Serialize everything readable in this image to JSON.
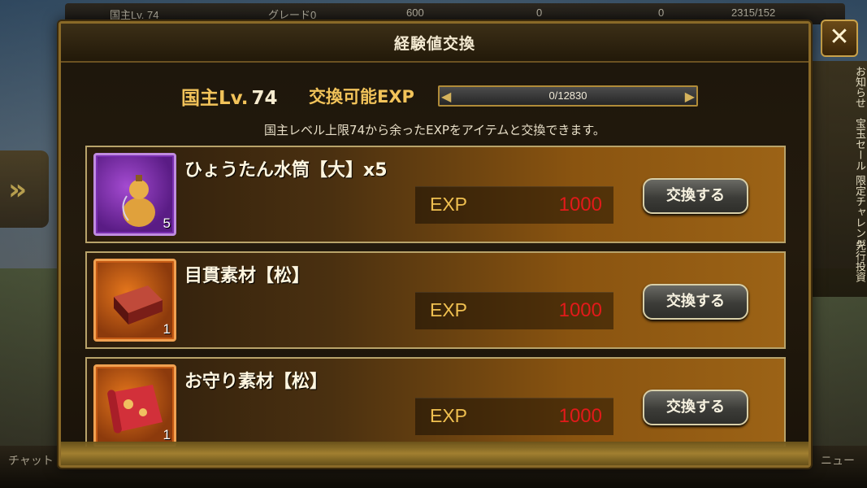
{
  "background": {
    "topbar": {
      "lord_label": "国主Lv. 74",
      "grade": "グレード0",
      "resource1": "600",
      "resource2": "0",
      "resource3": "0",
      "resource4": "2315/152"
    },
    "side_menu": [
      "お知らせ",
      "宝玉セール",
      "限定チャレンジ",
      "先行投資"
    ],
    "bottom": {
      "chat": "チャット",
      "menu": "ニュー"
    }
  },
  "modal": {
    "title": "経験値交換",
    "close_label": "✕",
    "lord_level_label": "国主Lv.",
    "lord_level_value": "74",
    "exchangeable_exp_label": "交換可能EXP",
    "exp_bar": {
      "text": "0/12830",
      "current": 0,
      "max": 12830
    },
    "info_text": "国主レベル上限74から余ったEXPをアイテムと交換できます。",
    "items": [
      {
        "name": "ひょうたん水筒【大】x5",
        "icon": "gourd-canteen-icon",
        "qty": "5",
        "exp_label": "EXP",
        "exp_value": "1000",
        "button": "交換する",
        "color": "#7a2fb0"
      },
      {
        "name": "目貫素材【松】",
        "icon": "red-ingot-icon",
        "qty": "1",
        "exp_label": "EXP",
        "exp_value": "1000",
        "button": "交換する",
        "color": "#c55a14"
      },
      {
        "name": "お守り素材【松】",
        "icon": "red-cloth-icon",
        "qty": "1",
        "exp_label": "EXP",
        "exp_value": "1000",
        "button": "交換する",
        "color": "#c55a14"
      }
    ]
  }
}
